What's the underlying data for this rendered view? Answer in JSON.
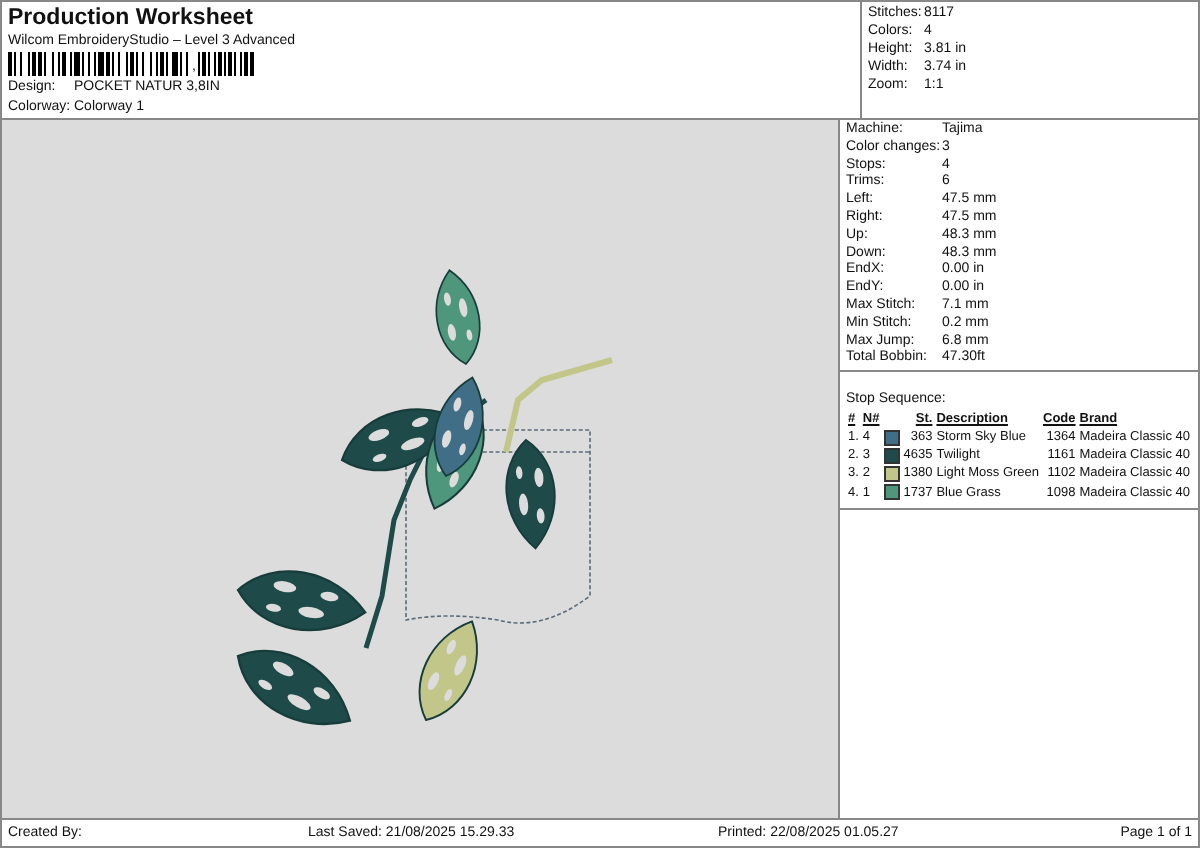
{
  "header": {
    "title": "Production Worksheet",
    "subtitle": "Wilcom EmbroideryStudio – Level 3 Advanced",
    "barcode_separator": ",",
    "design": {
      "label": "Design:",
      "value": "POCKET NATUR 3,8IN"
    },
    "colorway": {
      "label": "Colorway:",
      "value": "Colorway 1"
    }
  },
  "summary": [
    {
      "label": "Stitches:",
      "value": "8117"
    },
    {
      "label": "Colors:",
      "value": "4"
    },
    {
      "label": "Height:",
      "value": "3.81 in"
    },
    {
      "label": "Width:",
      "value": "3.74 in"
    },
    {
      "label": "Zoom:",
      "value": "1:1"
    }
  ],
  "machine_info": [
    {
      "label": "Machine:",
      "value": "Tajima"
    },
    {
      "label": "Color changes:",
      "value": "3"
    },
    {
      "label": "Stops:",
      "value": "4"
    },
    {
      "label": "Trims:",
      "value": "6"
    },
    {
      "label": "Left:",
      "value": "47.5 mm"
    },
    {
      "label": "Right:",
      "value": "47.5 mm"
    },
    {
      "label": "Up:",
      "value": "48.3 mm"
    },
    {
      "label": "Down:",
      "value": "48.3 mm"
    },
    {
      "label": "EndX:",
      "value": "0.00 in"
    },
    {
      "label": "EndY:",
      "value": "0.00 in"
    },
    {
      "label": "Max Stitch:",
      "value": "7.1 mm"
    },
    {
      "label": "Min Stitch:",
      "value": "0.2 mm"
    },
    {
      "label": "Max Jump:",
      "value": "6.8 mm"
    },
    {
      "label": "Total Bobbin:",
      "value": "47.30ft"
    }
  ],
  "stop_sequence": {
    "title": "Stop Sequence:",
    "columns": [
      "#",
      "N#",
      "St.",
      "Description",
      "Code",
      "Brand"
    ],
    "rows": [
      {
        "index": "1.",
        "needle": "4",
        "color": "#3f6e86",
        "stitches": "363",
        "description": "Storm Sky Blue",
        "code": "1364",
        "brand": "Madeira Classic 40"
      },
      {
        "index": "2.",
        "needle": "3",
        "color": "#1e4a4a",
        "stitches": "4635",
        "description": "Twilight",
        "code": "1161",
        "brand": "Madeira Classic 40"
      },
      {
        "index": "3.",
        "needle": "2",
        "color": "#c2c689",
        "stitches": "1380",
        "description": "Light Moss Green",
        "code": "1102",
        "brand": "Madeira Classic 40"
      },
      {
        "index": "4.",
        "needle": "1",
        "color": "#4e967c",
        "stitches": "1737",
        "description": "Blue Grass",
        "code": "1098",
        "brand": "Madeira Classic 40"
      }
    ]
  },
  "footer": {
    "created_by": "Created By:",
    "last_saved": "Last Saved: 21/08/2025 15.29.33",
    "printed": "Printed: 22/08/2025 01.05.27",
    "page": "Page 1 of 1"
  }
}
